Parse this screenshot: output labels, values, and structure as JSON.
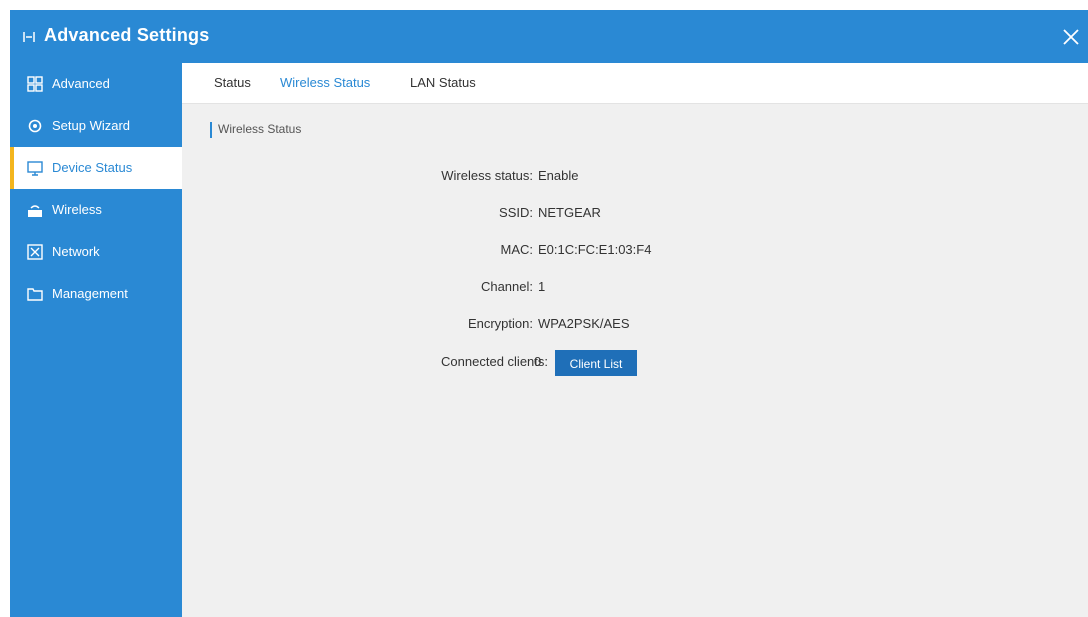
{
  "window": {
    "title": "Advanced Settings"
  },
  "sidebar": {
    "items": [
      {
        "label": "Advanced",
        "icon": "grid-icon",
        "active": false
      },
      {
        "label": "Setup Wizard",
        "icon": "gear-icon",
        "active": false
      },
      {
        "label": "Device Status",
        "icon": "monitor-icon",
        "active": true
      },
      {
        "label": "Wireless",
        "icon": "wifi-icon",
        "active": false
      },
      {
        "label": "Network",
        "icon": "network-icon",
        "active": false
      },
      {
        "label": "Management",
        "icon": "folder-icon",
        "active": false
      }
    ]
  },
  "tabs": [
    {
      "label": "Status",
      "active": false
    },
    {
      "label": "Wireless Status",
      "active": true
    },
    {
      "label": "LAN Status",
      "active": false
    }
  ],
  "main": {
    "section_title": "Wireless Status",
    "rows": [
      {
        "label": "Wireless status:",
        "value": "Enable"
      },
      {
        "label": "SSID:",
        "value": "NETGEAR"
      },
      {
        "label": "MAC:",
        "value": "E0:1C:FC:E1:03:F4"
      },
      {
        "label": "Channel:",
        "value": "1"
      },
      {
        "label": "Encryption:",
        "value": "WPA2PSK/AES"
      }
    ],
    "bind_row": {
      "label": "Connected clients:",
      "value": "0",
      "button": "Client List"
    }
  },
  "colors": {
    "primary": "#2a89d4",
    "active_accent": "#f3b51d",
    "button": "#1f6fb8",
    "background": "#f0f0f0"
  }
}
